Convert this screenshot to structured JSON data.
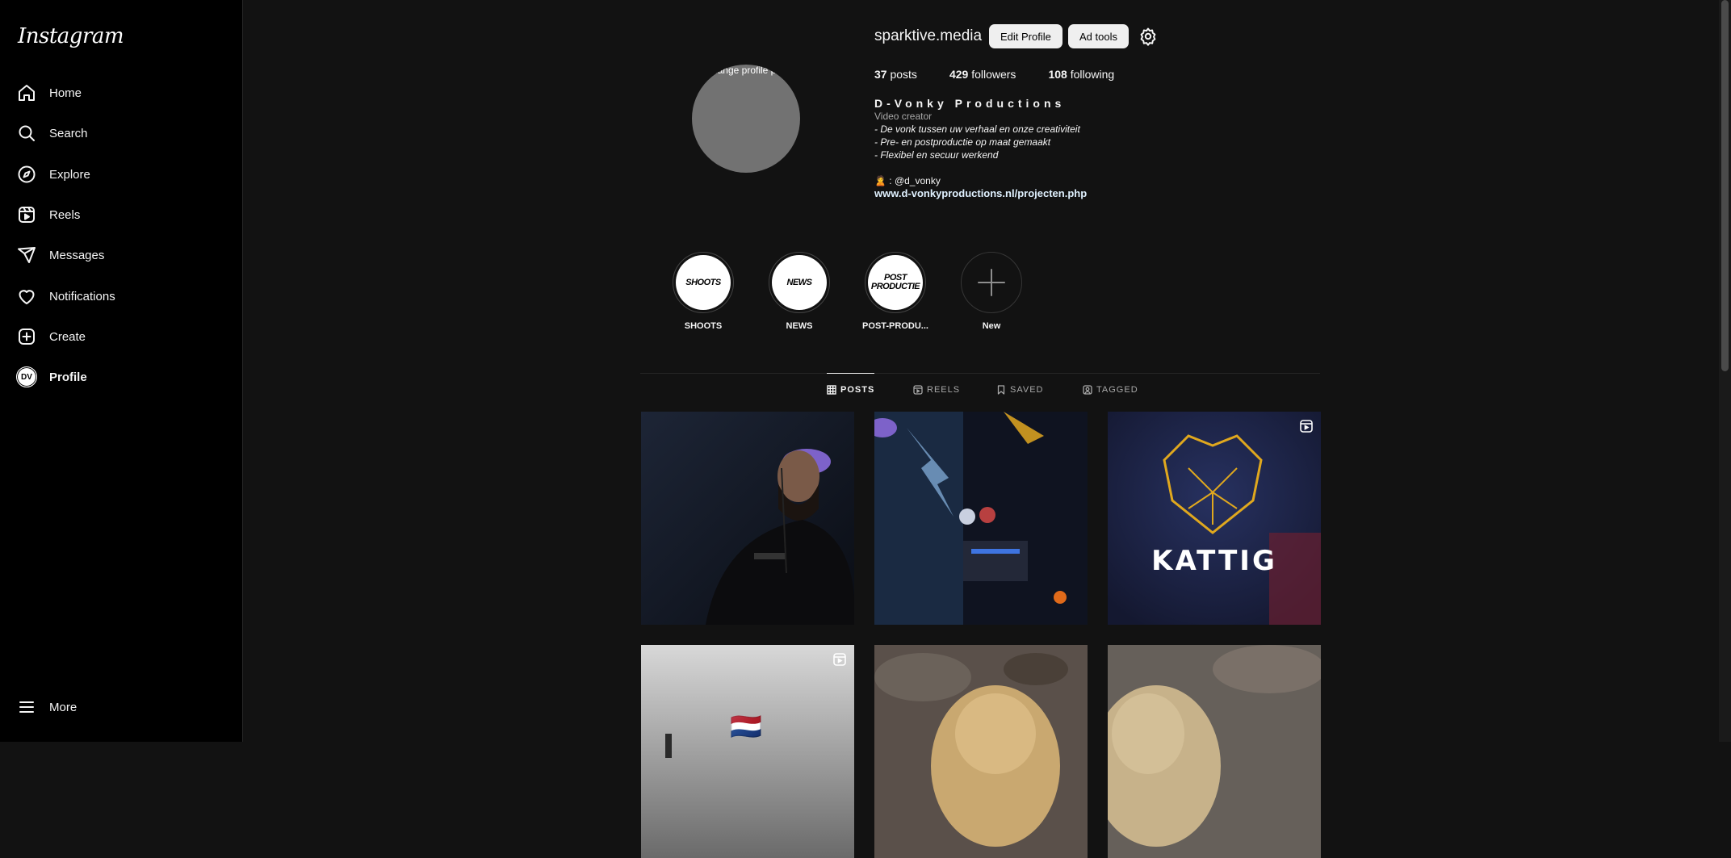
{
  "app": {
    "logo": "Instagram"
  },
  "sidebar": {
    "items": [
      {
        "label": "Home"
      },
      {
        "label": "Search"
      },
      {
        "label": "Explore"
      },
      {
        "label": "Reels"
      },
      {
        "label": "Messages"
      },
      {
        "label": "Notifications"
      },
      {
        "label": "Create"
      },
      {
        "label": "Profile",
        "avatar": "DV"
      }
    ],
    "more_label": "More"
  },
  "profile": {
    "picture_alt": "Change profile photo",
    "username": "sparktive.media",
    "edit_button": "Edit Profile",
    "ad_tools_button": "Ad tools",
    "stats": {
      "posts_count": "37",
      "posts_label": "posts",
      "followers_count": "429",
      "followers_label": "followers",
      "following_count": "108",
      "following_label": "following"
    },
    "bio": {
      "name": "D-Vonky Productions",
      "category": "Video creator",
      "lines": [
        "- De vonk tussen uw verhaal en onze creativiteit",
        "- Pre- en postproductie op maat gemaakt",
        "- Flexibel en secuur werkend"
      ],
      "contact": "🙎 : @d_vonky",
      "link": "www.d-vonkyproductions.nl/projecten.php"
    }
  },
  "highlights": [
    {
      "cover": "SHOOTS",
      "label": "SHOOTS"
    },
    {
      "cover": "NEWS",
      "label": "NEWS"
    },
    {
      "cover": "POST PRODUCTIE",
      "label": "POST-PRODU..."
    },
    {
      "label": "New"
    }
  ],
  "tabs": [
    {
      "label": "POSTS",
      "active": true
    },
    {
      "label": "REELS"
    },
    {
      "label": "SAVED"
    },
    {
      "label": "TAGGED"
    }
  ],
  "posts": [
    {
      "kind": "photo",
      "description": "DJ in black shirt and purple cap"
    },
    {
      "kind": "photo",
      "description": "DJ booth with lightning backdrop"
    },
    {
      "kind": "reel",
      "text": "KATTIG"
    },
    {
      "kind": "reel",
      "flag": "🇳🇱"
    },
    {
      "kind": "photo"
    },
    {
      "kind": "photo"
    }
  ],
  "colors": {
    "background": "#121212",
    "sidebar": "#000000",
    "link": "#e0f1ff",
    "button": "#efefef"
  }
}
